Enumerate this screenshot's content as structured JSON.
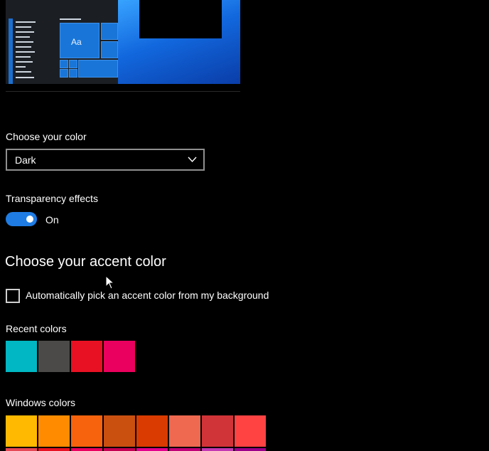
{
  "preview": {
    "tile_label": "Aa"
  },
  "color_mode": {
    "label": "Choose your color",
    "selected": "Dark"
  },
  "transparency": {
    "label": "Transparency effects",
    "state": "On",
    "enabled": true
  },
  "accent": {
    "title": "Choose your accent color",
    "auto_pick_label": "Automatically pick an accent color from my background",
    "auto_pick_checked": false,
    "recent_label": "Recent colors",
    "recent_colors": [
      "#00b7c3",
      "#4c4a48",
      "#e81123",
      "#ea005e"
    ],
    "windows_label": "Windows colors",
    "windows_colors_row1": [
      "#ffb900",
      "#ff8c00",
      "#f7630c",
      "#ca5010",
      "#da3b01",
      "#ef6950",
      "#d13438",
      "#ff4343"
    ],
    "windows_colors_row2": [
      "#e74856",
      "#e81123",
      "#ea005e",
      "#c30052",
      "#e3008c",
      "#bf0077",
      "#c239b3",
      "#9a0089"
    ]
  }
}
